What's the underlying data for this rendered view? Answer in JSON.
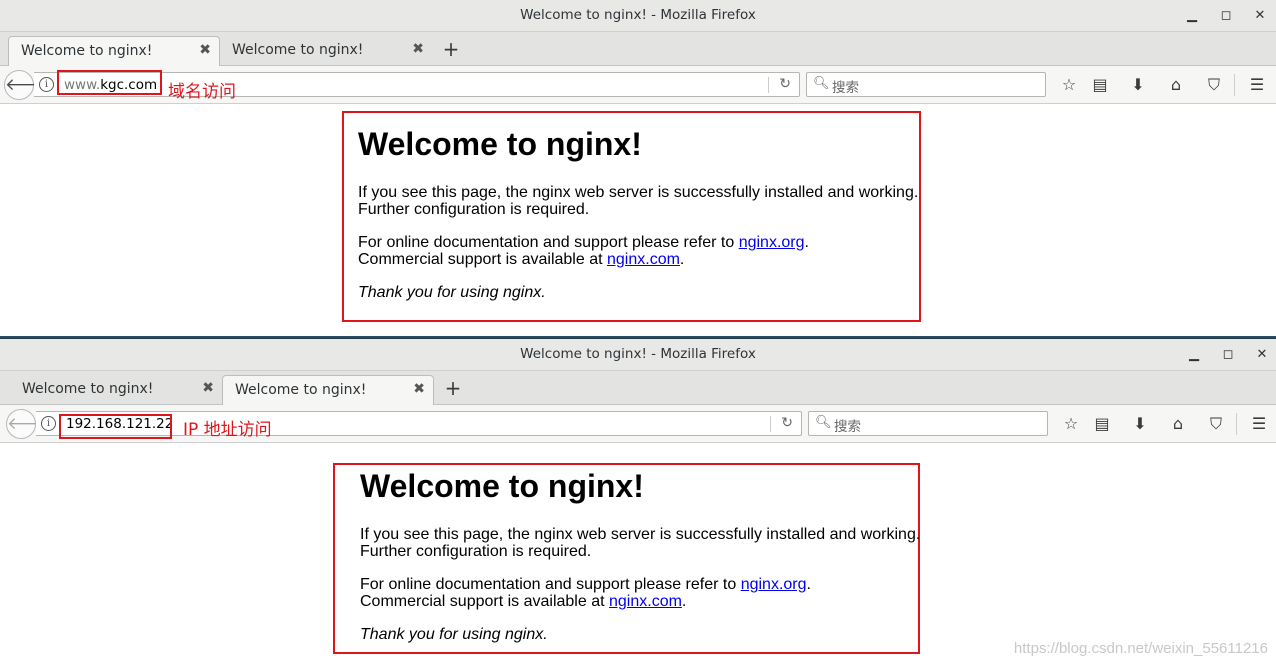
{
  "windows": [
    {
      "title": "Welcome to nginx! - Mozilla Firefox",
      "tabs": [
        {
          "label": "Welcome to nginx!",
          "active": true
        },
        {
          "label": "Welcome to nginx!",
          "active": false
        }
      ],
      "url": {
        "prefix": "www.",
        "main": "kgc.com"
      },
      "annotation": "域名访问",
      "search_placeholder": "搜索",
      "page": {
        "heading": "Welcome to nginx!",
        "p1_line1": "If you see this page, the nginx web server is successfully installed and working.",
        "p1_line2": "Further configuration is required.",
        "p2_line1_pre": "For online documentation and support please refer to ",
        "p2_link1": "nginx.org",
        "p2_line1_post": ".",
        "p2_line2_pre": "Commercial support is available at ",
        "p2_link2": "nginx.com",
        "p2_line2_post": ".",
        "p3": "Thank you for using nginx."
      }
    },
    {
      "title": "Welcome to nginx! - Mozilla Firefox",
      "tabs": [
        {
          "label": "Welcome to nginx!",
          "active": false
        },
        {
          "label": "Welcome to nginx!",
          "active": true
        }
      ],
      "url": {
        "prefix": "",
        "main": "192.168.121.22"
      },
      "annotation": "IP 地址访问",
      "search_placeholder": "搜索",
      "page": {
        "heading": "Welcome to nginx!",
        "p1_line1": "If you see this page, the nginx web server is successfully installed and working.",
        "p1_line2": "Further configuration is required.",
        "p2_line1_pre": "For online documentation and support please refer to ",
        "p2_link1": "nginx.org",
        "p2_line1_post": ".",
        "p2_line2_pre": "Commercial support is available at ",
        "p2_link2": "nginx.com",
        "p2_line2_post": ".",
        "p3": "Thank you for using nginx."
      }
    }
  ],
  "icons": {
    "minimize": "minimize-icon",
    "maximize": "maximize-icon",
    "close": "close-icon",
    "back": "back-arrow-icon",
    "info": "info-icon",
    "reload": "reload-icon",
    "search": "search-icon",
    "bookmark": "star-icon",
    "reading_list": "clipboard-icon",
    "downloads": "download-arrow-icon",
    "home": "home-icon",
    "pocket": "pocket-icon",
    "menu": "hamburger-menu-icon"
  },
  "colors": {
    "annotation": "#e0151b",
    "link": "#0000ee"
  },
  "watermark": "https://blog.csdn.net/weixin_55611216"
}
